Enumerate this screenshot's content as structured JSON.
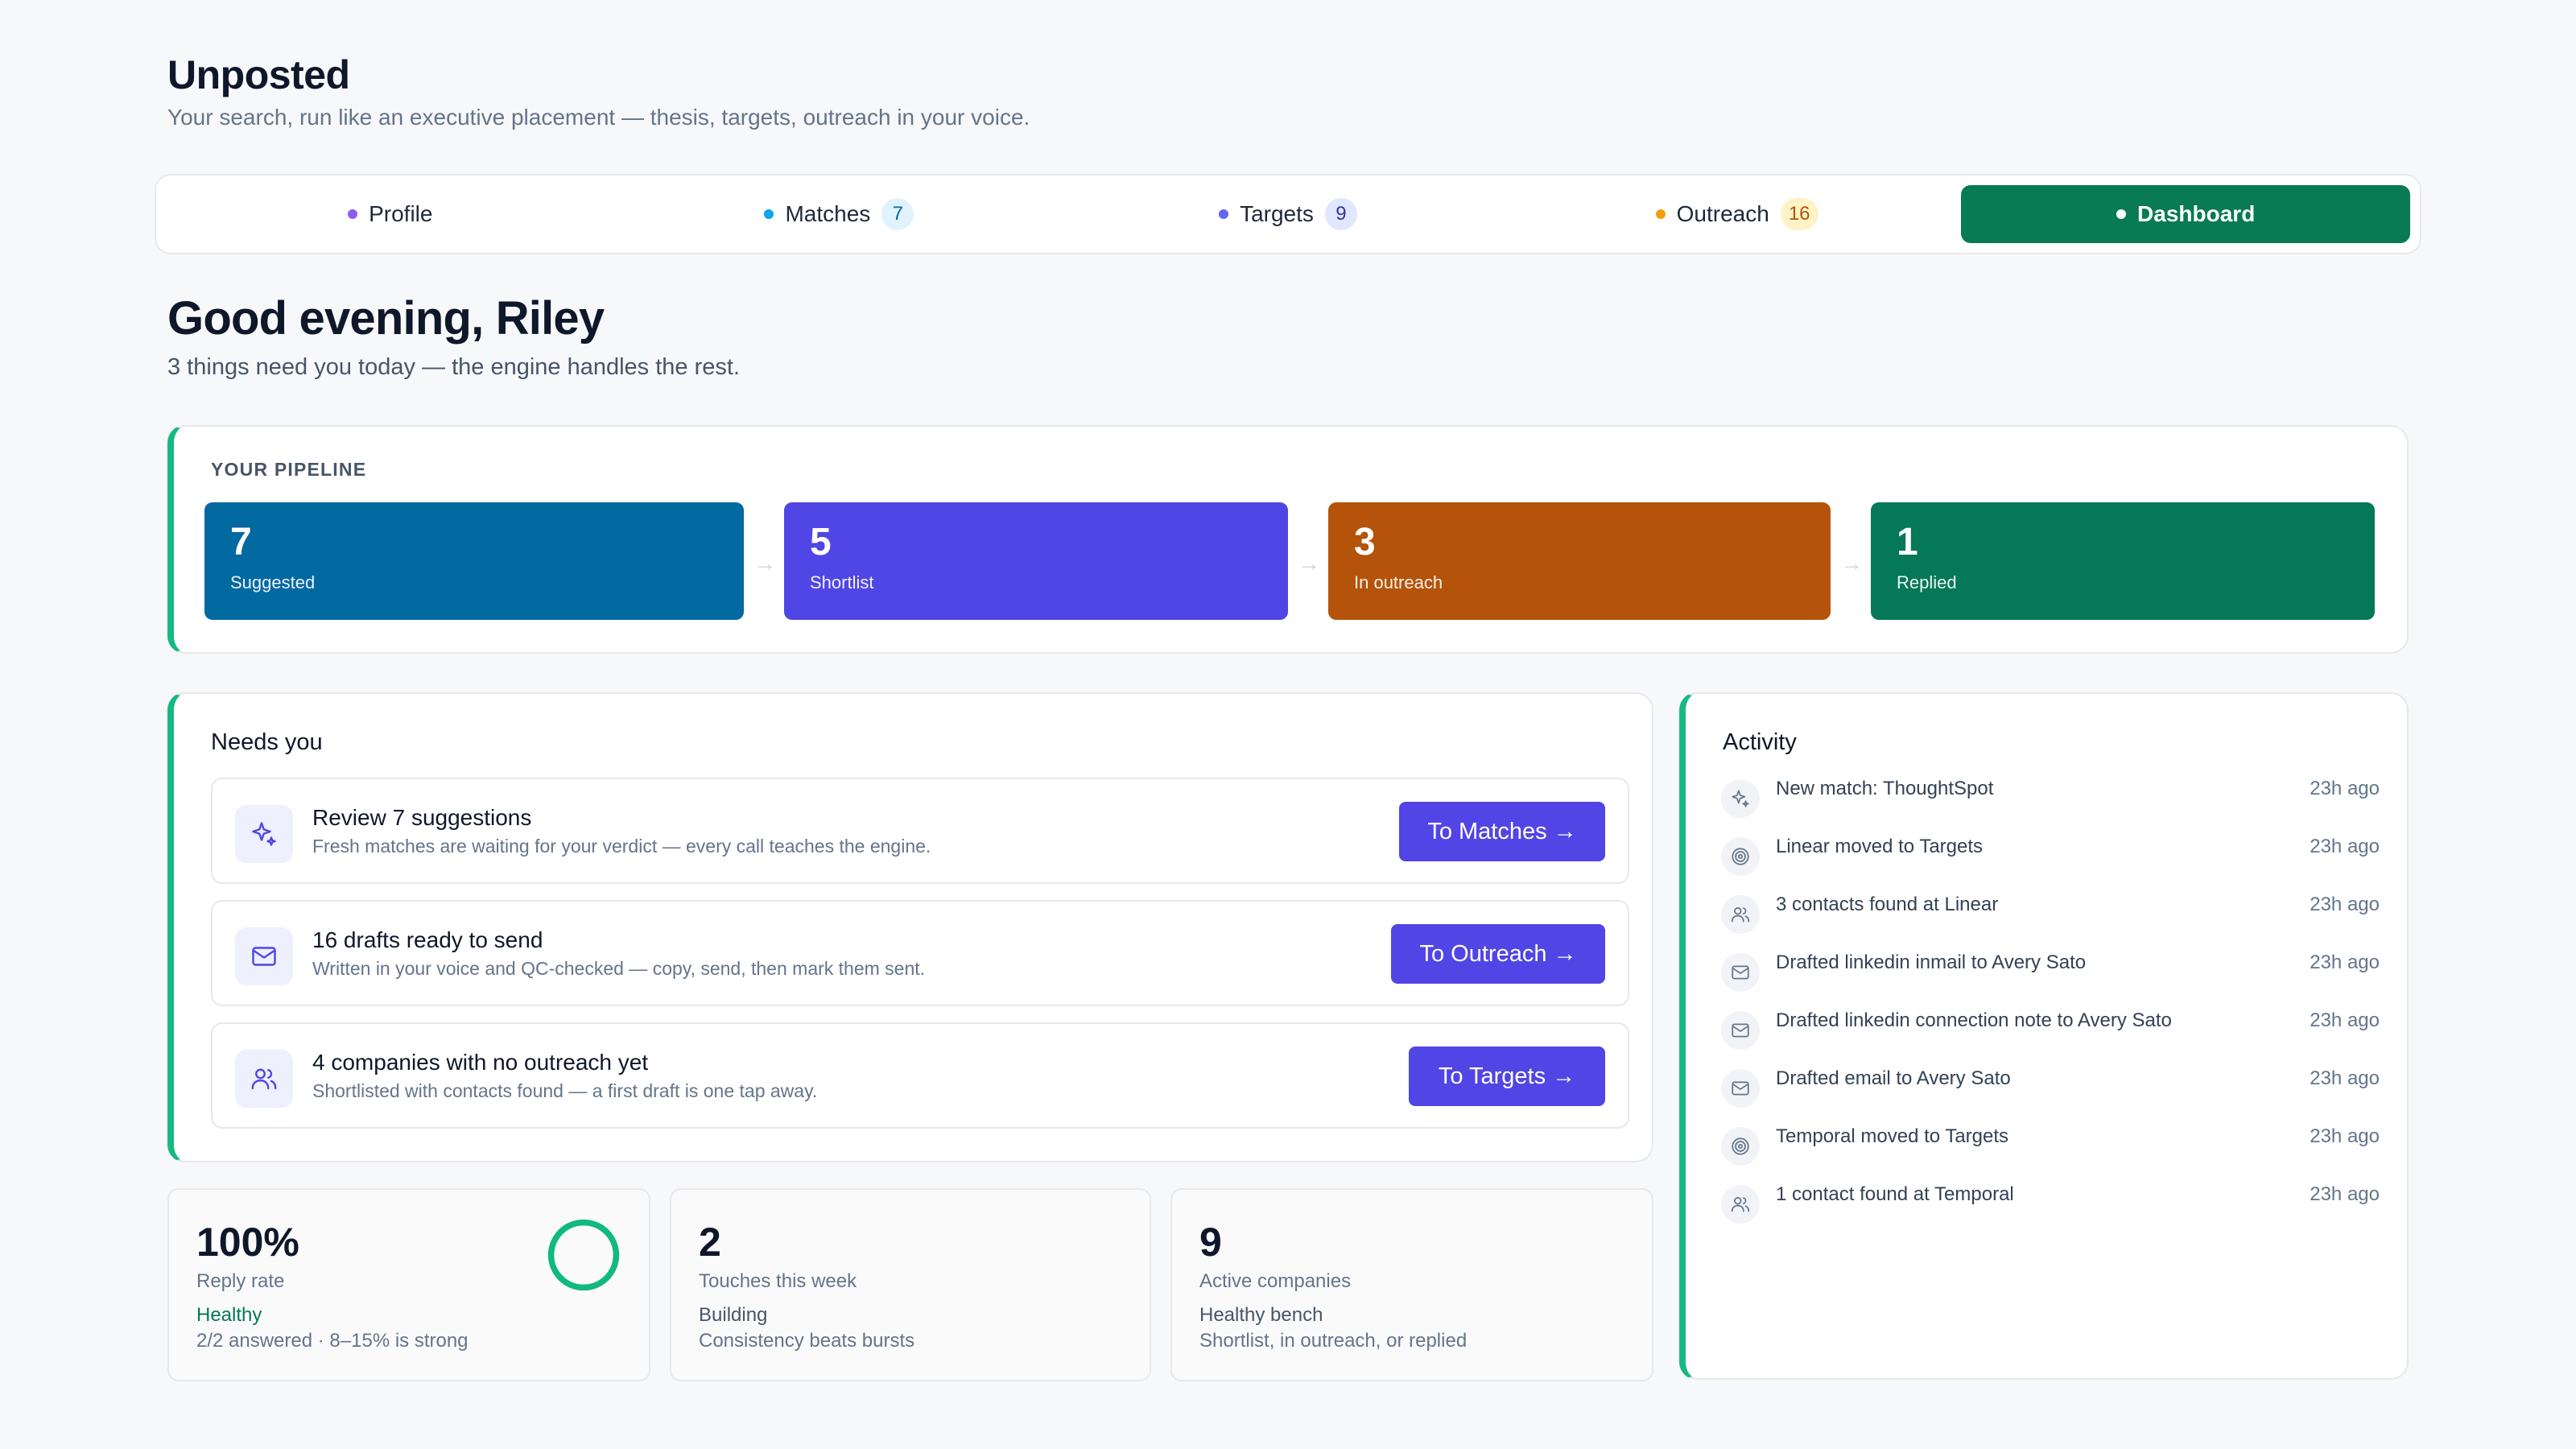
{
  "app": {
    "title": "Unposted",
    "subtitle": "Your search, run like an executive placement — thesis, targets, outreach in your voice."
  },
  "nav": {
    "tabs": [
      {
        "label": "Profile",
        "badge": "",
        "dot_color": "#8b5cf6"
      },
      {
        "label": "Matches",
        "badge": "7",
        "dot_color": "#0ea5e9",
        "badge_bg": "#e0f2fe",
        "badge_fg": "#0369a1"
      },
      {
        "label": "Targets",
        "badge": "9",
        "dot_color": "#6366f1",
        "badge_bg": "#e0e7ff",
        "badge_fg": "#3730a3"
      },
      {
        "label": "Outreach",
        "badge": "16",
        "dot_color": "#f59e0b",
        "badge_bg": "#fef3c7",
        "badge_fg": "#b45309"
      },
      {
        "label": "Dashboard",
        "badge": "",
        "dot_color": "#ffffff",
        "active": true
      }
    ]
  },
  "greeting": {
    "title": "Good evening, Riley",
    "subtitle": "3 things need you today — the engine handles the rest."
  },
  "pipeline": {
    "label": "YOUR PIPELINE",
    "stages": [
      {
        "count": "7",
        "label": "Suggested",
        "color": "#0369a1"
      },
      {
        "count": "5",
        "label": "Shortlist",
        "color": "#4f46e5"
      },
      {
        "count": "3",
        "label": "In outreach",
        "color": "#b45309"
      },
      {
        "count": "1",
        "label": "Replied",
        "color": "#047857"
      }
    ],
    "arrow": "→"
  },
  "needs_you": {
    "title": "Needs you",
    "tasks": [
      {
        "title": "Review 7 suggestions",
        "desc": "Fresh matches are waiting for your verdict — every call teaches the engine.",
        "button": "To Matches →",
        "icon": "sparkle-icon"
      },
      {
        "title": "16 drafts ready to send",
        "desc": "Written in your voice and QC-checked — copy, send, then mark them sent.",
        "button": "To Outreach →",
        "icon": "mail-icon"
      },
      {
        "title": "4 companies with no outreach yet",
        "desc": "Shortlisted with contacts found — a first draft is one tap away.",
        "button": "To Targets →",
        "icon": "users-icon"
      }
    ]
  },
  "activity": {
    "title": "Activity",
    "items": [
      {
        "text": "New match: ThoughtSpot",
        "time": "23h ago",
        "icon": "sparkle-icon"
      },
      {
        "text": "Linear moved to Targets",
        "time": "23h ago",
        "icon": "target-icon"
      },
      {
        "text": "3 contacts found at Linear",
        "time": "23h ago",
        "icon": "users-icon"
      },
      {
        "text": "Drafted linkedin inmail to Avery Sato",
        "time": "23h ago",
        "icon": "mail-icon"
      },
      {
        "text": "Drafted linkedin connection note to Avery Sato",
        "time": "23h ago",
        "icon": "mail-icon"
      },
      {
        "text": "Drafted email to Avery Sato",
        "time": "23h ago",
        "icon": "mail-icon"
      },
      {
        "text": "Temporal moved to Targets",
        "time": "23h ago",
        "icon": "target-icon"
      },
      {
        "text": "1 contact found at Temporal",
        "time": "23h ago",
        "icon": "users-icon"
      }
    ]
  },
  "stats": [
    {
      "value": "100%",
      "name": "Reply rate",
      "status": "Healthy",
      "hint": "2/2 answered · 8–15% is strong",
      "status_color": "#047857",
      "ring_fraction": 1.0,
      "ring_color": "#10b981"
    },
    {
      "value": "2",
      "name": "Touches this week",
      "status": "Building",
      "hint": "Consistency beats bursts"
    },
    {
      "value": "9",
      "name": "Active companies",
      "status": "Healthy bench",
      "hint": "Shortlist, in outreach, or replied"
    }
  ],
  "colors": {
    "accent_green": "#10b981",
    "primary_button": "#4f46e5",
    "active_tab": "#087a54"
  }
}
